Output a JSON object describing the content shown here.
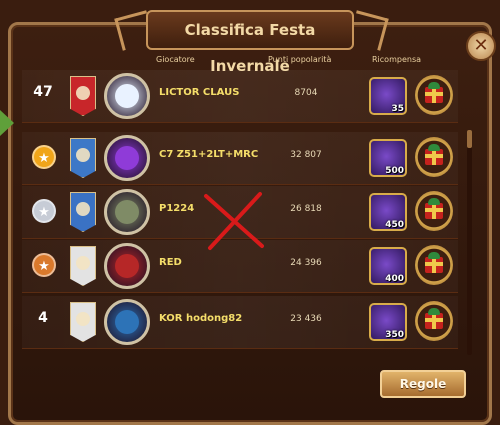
{
  "window": {
    "title": "Classifica Festa Invernale",
    "close_glyph": "✕"
  },
  "table": {
    "headers": {
      "player": "Giocatore",
      "points": "Punti popolarità",
      "reward": "Ricompensa"
    },
    "rows": [
      {
        "rank": "47",
        "medal": "none",
        "banner_color": "#c8262a",
        "avatar_color": "#e9f2ff",
        "name": "LICTOR CLAUS",
        "points": "8704",
        "reward_count": "35"
      },
      {
        "rank": "",
        "medal": "gold",
        "banner_color": "#3d78c7",
        "avatar_color": "#8f3bd8",
        "name": "C7 Z51+2LT+MRC",
        "points": "32 807",
        "reward_count": "500"
      },
      {
        "rank": "",
        "medal": "silver",
        "banner_color": "#3a72c4",
        "avatar_color": "#7f8b66",
        "name": "P1224",
        "points": "26 818",
        "reward_count": "450"
      },
      {
        "rank": "",
        "medal": "bronze",
        "banner_color": "#e3e3e3",
        "avatar_color": "#b62727",
        "name": "RED",
        "points": "24 396",
        "reward_count": "400"
      },
      {
        "rank": "4",
        "medal": "none",
        "banner_color": "#e3e3e3",
        "avatar_color": "#2d73b7",
        "name": "KOR hodong82",
        "points": "23 436",
        "reward_count": "350"
      }
    ]
  },
  "buttons": {
    "rules": "Regole"
  },
  "colors": {
    "gold": "#f0a51a",
    "silver": "#c7ccd6",
    "bronze": "#d9792c",
    "name_text": "#f5de6a",
    "strike": "#d91a1a"
  },
  "icons": {
    "reward_box": "purple-energy-chest-icon",
    "gift": "gift-icon",
    "medal": "medal-icon",
    "cross": "red-x-mark"
  }
}
